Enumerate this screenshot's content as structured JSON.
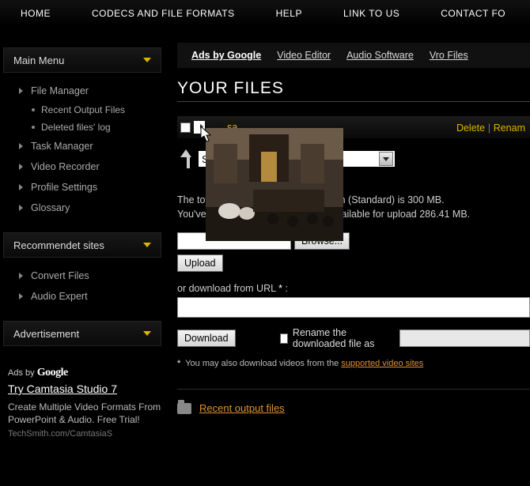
{
  "topnav": [
    "HOME",
    "CODECS AND FILE FORMATS",
    "HELP",
    "LINK TO US",
    "CONTACT FO"
  ],
  "sidebar": {
    "mainmenu_title": "Main Menu",
    "items": [
      {
        "label": "File Manager",
        "sub": [
          "Recent Output Files",
          "Deleted files' log"
        ]
      },
      {
        "label": "Task Manager"
      },
      {
        "label": "Video Recorder"
      },
      {
        "label": "Profile Settings"
      },
      {
        "label": "Glossary"
      }
    ],
    "recsites_title": "Recommendet sites",
    "recsites": [
      {
        "label": "Convert Files"
      },
      {
        "label": "Audio Expert"
      }
    ],
    "advert_title": "Advertisement",
    "ad": {
      "lead": "Ads by",
      "brand": "Google",
      "title": "Try Camtasia Studio 7",
      "body": "Create Multiple Video Formats From PowerPoint & Audio. Free Trial!",
      "url": "TechSmith.com/CamtasiaS"
    }
  },
  "main": {
    "adbar": {
      "lead": "Ads by Google",
      "links": [
        "Video Editor",
        "Audio Software",
        "Vro Files"
      ]
    },
    "page_title": "YOUR FILES",
    "filerow": {
      "sa": "sa",
      "delete": "Delete",
      "rename": "Renam"
    },
    "select_label": "Sel",
    "note_line1": "The total",
    "note_line1b": "n (Standard) is 300 MB.",
    "note_line2a": "You've us",
    "note_line2b": "available for upload 286.41 MB.",
    "browse": "Browse...",
    "upload": "Upload",
    "or_dl": "or download from URL",
    "ast": "*",
    "colon": ":",
    "download": "Download",
    "rename_cb": "Rename the downloaded file as",
    "foot_note_a": "You may also download videos from the",
    "foot_note_link": "supported video sites",
    "recent_link": "Recent output files"
  }
}
